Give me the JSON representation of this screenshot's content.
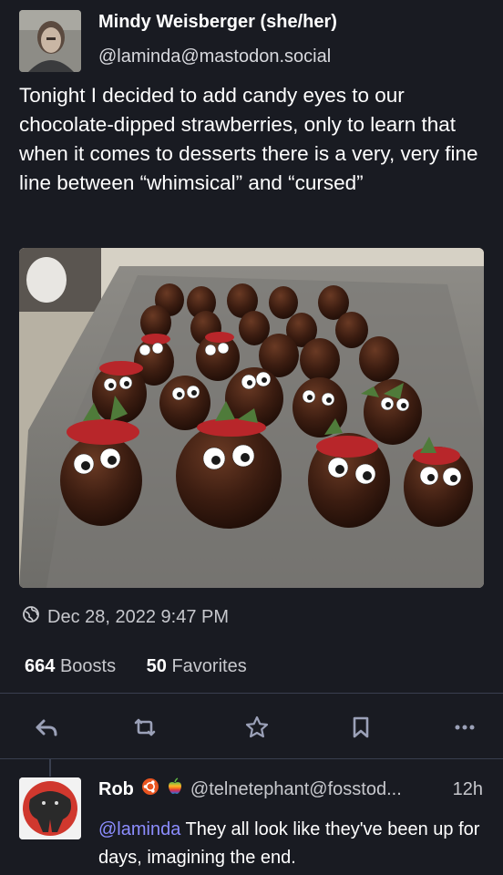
{
  "post": {
    "author": {
      "display_name": "Mindy Weisberger (she/her)",
      "handle": "@laminda@mastodon.social"
    },
    "text": "Tonight I decided to add candy eyes to our chocolate-dipped strawberries, only to learn that when it comes to desserts there is a very, very fine line between “whimsical” and “cursed”",
    "timestamp": "Dec 28, 2022 9:47 PM",
    "boosts_count": "664",
    "boosts_label": "Boosts",
    "favorites_count": "50",
    "favorites_label": "Favorites",
    "icons": {
      "visibility": "globe-icon",
      "reply": "reply-icon",
      "boost": "boost-icon",
      "favorite": "star-icon",
      "bookmark": "bookmark-icon",
      "more": "more-icon"
    }
  },
  "reply": {
    "author": {
      "display_name": "Rob",
      "handle": "@telnetephant@fosstod...",
      "time": "12h"
    },
    "mention": "@laminda",
    "text": " They all look like they've been up for days, imagining the end."
  },
  "colors": {
    "background": "#191b22",
    "secondary_text": "#c7c8cd",
    "mention": "#8c8dff",
    "divider": "#393f4f"
  }
}
